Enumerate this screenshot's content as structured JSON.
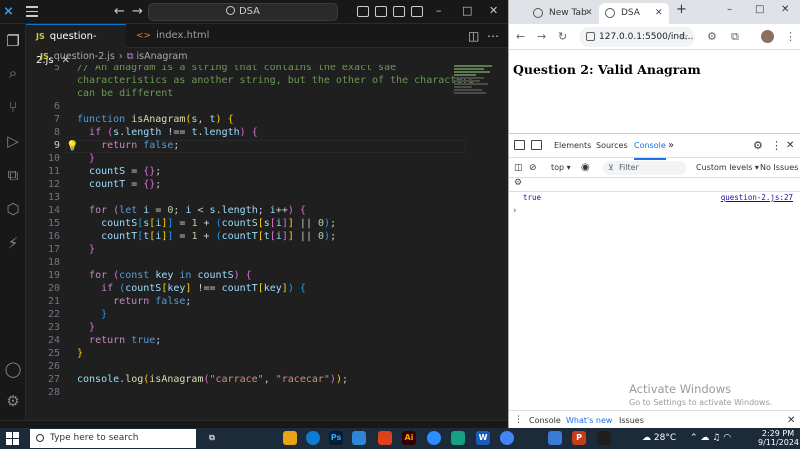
{
  "vscode": {
    "search": "DSA",
    "tabs": [
      {
        "label": "question-2.js",
        "badge": "JS",
        "active": true
      },
      {
        "label": "index.html",
        "badge": "<>",
        "active": false
      }
    ],
    "breadcrumb": {
      "file_badge": "JS",
      "file": "question-2.js",
      "symbol": "isAnagram"
    },
    "line_numbers": [
      "5",
      "",
      "",
      "6",
      "7",
      "8",
      "9",
      "10",
      "11",
      "12",
      "13",
      "14",
      "15",
      "16",
      "17",
      "18",
      "19",
      "20",
      "21",
      "22",
      "23",
      "24",
      "25",
      "26",
      "27",
      "28"
    ],
    "comment_lines": [
      "// An anagram is a string that contains the exact sae",
      "characteristics as another string, but the other of the characters",
      "can be different"
    ]
  },
  "browser": {
    "tabs": [
      {
        "label": "New Tab"
      },
      {
        "label": "DSA",
        "active": true
      }
    ],
    "url": "127.0.0.1:5500/ind...",
    "page_heading": "Question 2: Valid Anagram",
    "devtools": {
      "tabs": [
        "Elements",
        "Sources",
        "Console"
      ],
      "active_tab": "Console",
      "context": "top",
      "filter_placeholder": "Filter",
      "levels": "Custom levels",
      "issues": "No Issues",
      "log_value": "true",
      "log_source": "question-2.js:27",
      "drawer_tabs": [
        "Console",
        "What's new",
        "Issues"
      ]
    },
    "activate_title": "Activate Windows",
    "activate_sub": "Go to Settings to activate Windows."
  },
  "taskbar": {
    "search_placeholder": "Type here to search",
    "weather": "28°C",
    "time": "2:29 PM",
    "date": "9/11/2024"
  },
  "colors": {
    "accent": "#0078d4",
    "vs_bg": "#1f1f1f",
    "taskbar": "#1c2b3a",
    "devtools_accent": "#1a73e8"
  }
}
